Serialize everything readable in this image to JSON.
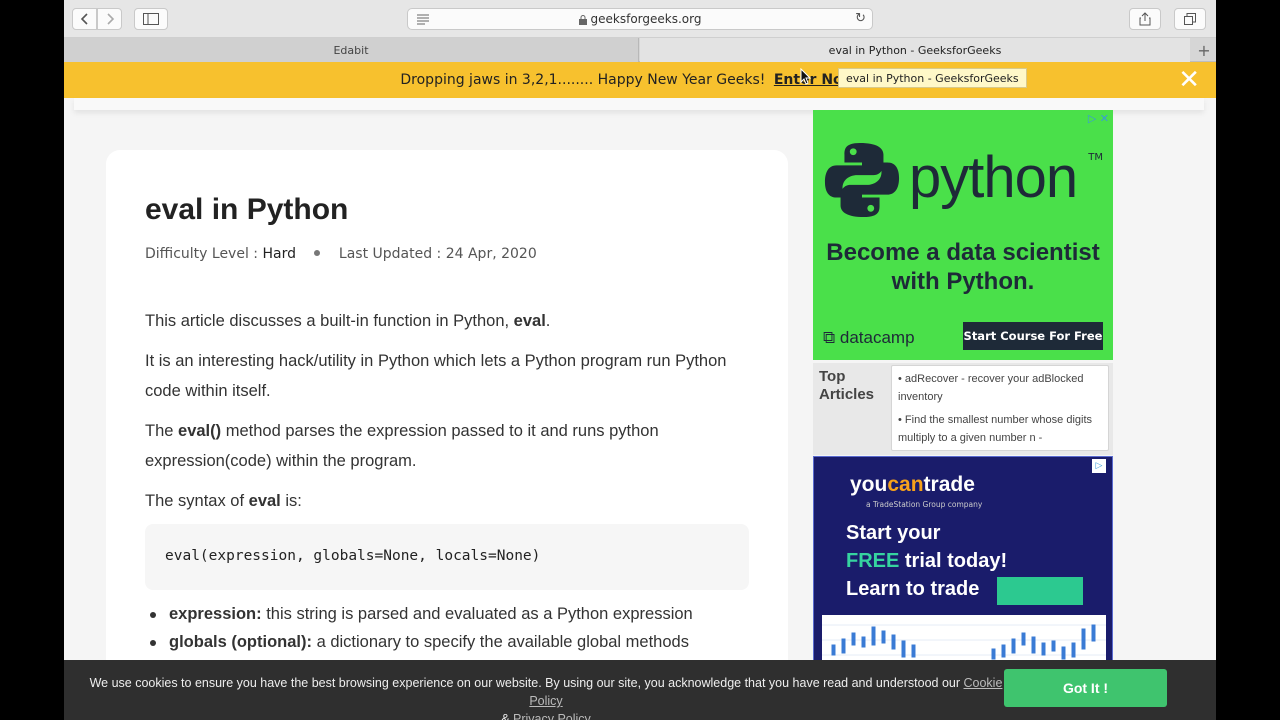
{
  "browser": {
    "url": "geeksforgeeks.org",
    "tabs": [
      "Edabit",
      "eval in Python - GeeksforGeeks"
    ],
    "tooltip": "eval in Python - GeeksforGeeks"
  },
  "banner": {
    "text": "Dropping jaws in 3,2,1........ Happy New Year Geeks!",
    "link": "Enter Now",
    "close": "✕"
  },
  "article": {
    "title": "eval in Python",
    "difficulty_label": "Difficulty Level :",
    "difficulty_value": "Hard",
    "updated": "Last Updated : 24 Apr, 2020",
    "p1_a": "This article discusses a built-in function in Python, ",
    "p1_b": "eval",
    "p1_c": ".",
    "p2": "It is an interesting hack/utility in Python which lets a Python program run Python code within itself.",
    "p3_a": "The ",
    "p3_b": "eval()",
    "p3_c": " method parses the expression passed to it and runs python expression(code) within the program.",
    "p4_a": "The syntax of ",
    "p4_b": "eval",
    "p4_c": " is:",
    "code": "eval(expression, globals=None, locals=None)",
    "bullets": [
      {
        "term": "expression:",
        "desc": " this string is parsed and evaluated as a Python expression"
      },
      {
        "term": "globals (optional):",
        "desc": " a dictionary to specify the available global methods"
      }
    ]
  },
  "ad_python": {
    "word": "python",
    "tm": "TM",
    "headline": "Become a data scientist with Python.",
    "brand": "datacamp",
    "button": "Start Course For Free"
  },
  "top_articles": {
    "label": "Top Articles",
    "items": [
      "adRecover - recover your adBlocked inventory",
      "Find the smallest number whose digits multiply to a given number n -"
    ]
  },
  "ad_trade": {
    "logo_a": "you",
    "logo_b": "can",
    "logo_c": "trade",
    "sub": "a TradeStation Group company",
    "line1": "Start your",
    "line2_a": "FREE",
    "line2_b": " trial today!",
    "line3": "Learn to trade"
  },
  "cookie": {
    "text": "We use cookies to ensure you have the best browsing experience on our website. By using our site, you acknowledge that you have read and understood our ",
    "cookie_link": "Cookie Policy",
    "amp": " & ",
    "privacy_link": "Privacy Policy",
    "button": "Got It !"
  },
  "colors": {
    "banner": "#f7c12e",
    "python_ad": "#4ae04a",
    "cookie_button": "#3fc46e"
  }
}
